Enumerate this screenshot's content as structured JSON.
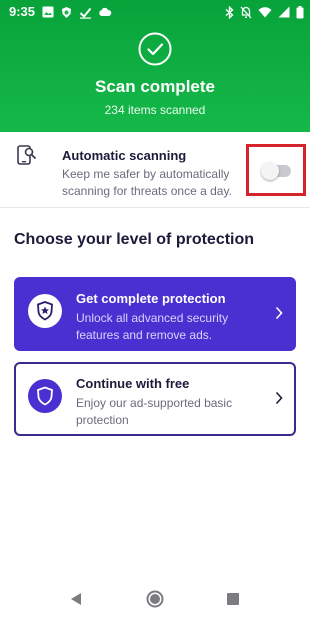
{
  "status_bar": {
    "time": "9:35",
    "left_icons": [
      "image-icon",
      "shield-bug-icon",
      "check-icon",
      "cloud-icon"
    ],
    "right_icons": [
      "bluetooth-icon",
      "mute-icon",
      "wifi-icon",
      "signal-icon",
      "battery-icon"
    ]
  },
  "header": {
    "icon": "check-circle-icon",
    "title": "Scan complete",
    "subtitle": "234 items scanned",
    "color": "#0aa83c"
  },
  "automatic_scanning": {
    "icon": "phone-search-icon",
    "title": "Automatic scanning",
    "description": "Keep me safer by automatically scanning for threats once a day.",
    "enabled": false,
    "highlight_color": "#d5242b"
  },
  "protection": {
    "heading": "Choose your level of protection",
    "options": [
      {
        "icon": "shield-star-icon",
        "title": "Get complete protection",
        "description": "Unlock all advanced security features and remove ads.",
        "color": "#4a30d0"
      },
      {
        "icon": "shield-icon",
        "title": "Continue with free",
        "description": "Enjoy our ad-supported basic protection",
        "color": "#3a2a8c"
      }
    ]
  },
  "nav_bar": {
    "buttons": [
      "back-icon",
      "home-icon",
      "recent-apps-icon"
    ]
  }
}
